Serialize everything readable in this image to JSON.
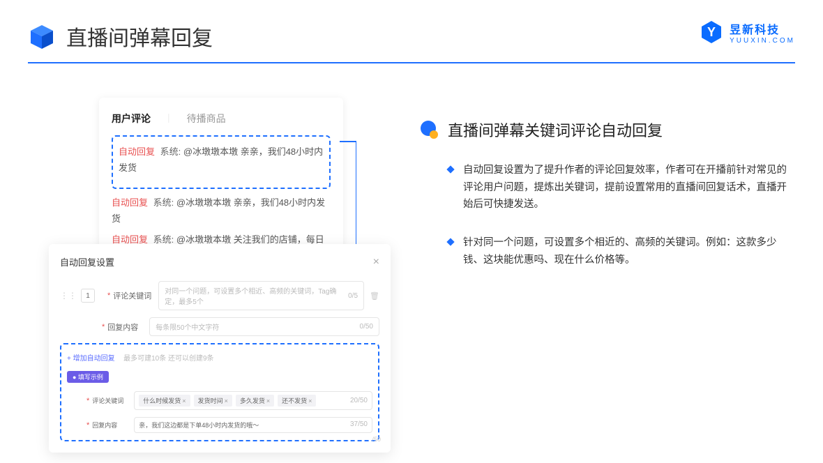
{
  "header": {
    "title": "直播间弹幕回复",
    "logo_main": "昱新科技",
    "logo_sub": "YUUXIN.COM"
  },
  "comments": {
    "tab_active": "用户评论",
    "tab_inactive": "待播商品",
    "items": [
      {
        "prefix": "自动回复",
        "sys": "系统:",
        "text": "@冰墩墩本墩 亲亲，我们48小时内发货"
      },
      {
        "prefix": "自动回复",
        "sys": "系统:",
        "text": "@冰墩墩本墩 亲亲，我们48小时内发货"
      },
      {
        "prefix": "自动回复",
        "sys": "系统:",
        "text": "@冰墩墩本墩 关注我们的店铺，每日都有热门推荐呦～"
      }
    ]
  },
  "settings": {
    "title": "自动回复设置",
    "index": "1",
    "row1_label": "评论关键词",
    "row1_placeholder": "对同一个问题，可设置多个相近、高频的关键词，Tag确定，最多5个",
    "row1_counter": "0/5",
    "row2_label": "回复内容",
    "row2_placeholder": "每条限50个中文字符",
    "row2_counter": "0/50",
    "add_link": "+ 增加自动回复",
    "add_hint": "最多可建10条 还可以创建9条",
    "badge": "● 填写示例",
    "ex_row1_label": "评论关键词",
    "ex_tags": [
      "什么时候发货",
      "发货时间",
      "多久发货",
      "还不发货"
    ],
    "ex_row1_counter": "20/50",
    "ex_row2_label": "回复内容",
    "ex_row2_value": "亲，我们这边都是下单48小时内发货的哦～",
    "ex_row2_counter": "37/50",
    "faint_counter": "/50"
  },
  "right": {
    "section_title": "直播间弹幕关键词评论自动回复",
    "bullets": [
      "自动回复设置为了提升作者的评论回复效率，作者可在开播前针对常见的评论用户问题，提炼出关键词，提前设置常用的直播间回复话术，直播开始后可快捷发送。",
      "针对同一个问题，可设置多个相近的、高频的关键词。例如：这款多少钱、这块能优惠吗、现在什么价格等。"
    ]
  }
}
